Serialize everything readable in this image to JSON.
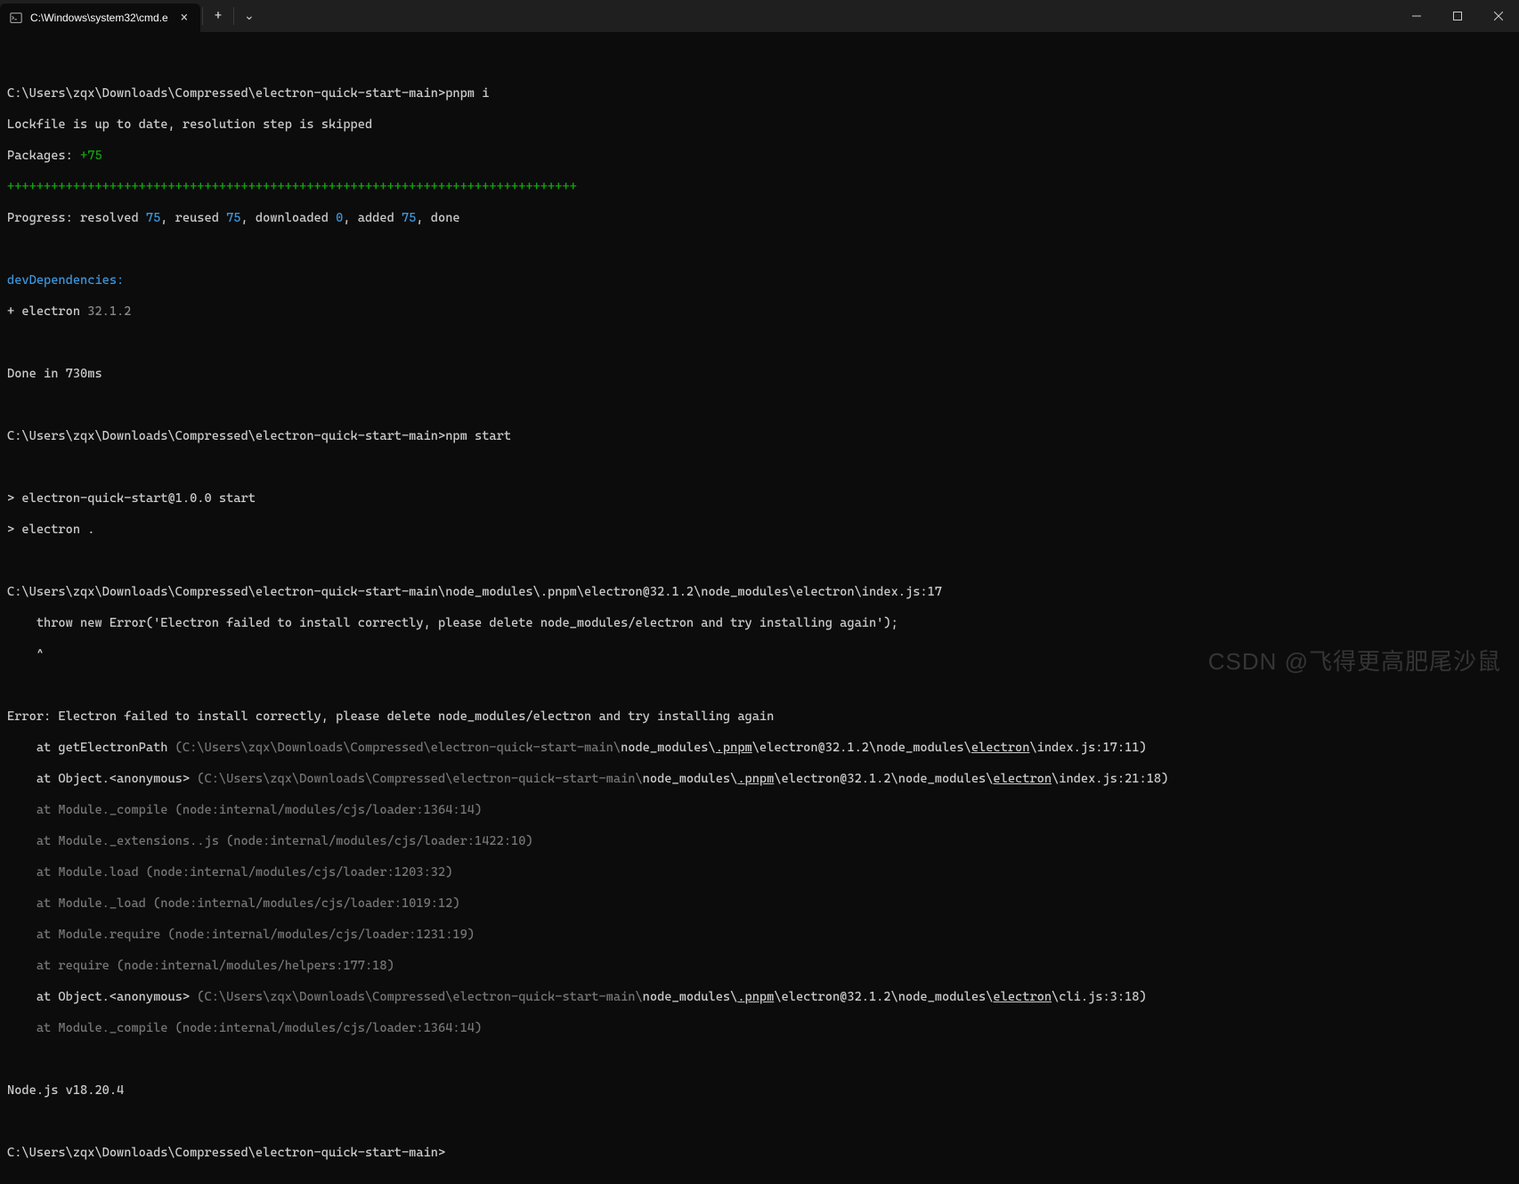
{
  "titlebar": {
    "tab_title": "C:\\Windows\\system32\\cmd.e",
    "tab_close": "×",
    "new_tab": "+",
    "dropdown": "⌄",
    "min": "—",
    "max": "□",
    "close": "×"
  },
  "term": {
    "l01_prompt": "C:\\Users\\zqx\\Downloads\\Compressed\\electron-quick-start-main>",
    "l01_cmd": "pnpm i",
    "l02": "Lockfile is up to date, resolution step is skipped",
    "l03a": "Packages: ",
    "l03b": "+75",
    "l04": "++++++++++++++++++++++++++++++++++++++++++++++++++++++++++++++++++++++++++++++",
    "l05_a": "Progress: resolved ",
    "l05_b": "75",
    "l05_c": ", reused ",
    "l05_d": "75",
    "l05_e": ", downloaded ",
    "l05_f": "0",
    "l05_g": ", added ",
    "l05_h": "75",
    "l05_i": ", done",
    "l07": "devDependencies:",
    "l08_a": "+ ",
    "l08_b": "electron ",
    "l08_c": "32.1.2",
    "l10": "Done in 730ms",
    "l12_prompt": "C:\\Users\\zqx\\Downloads\\Compressed\\electron-quick-start-main>",
    "l12_cmd": "npm start",
    "l14": "> electron-quick-start@1.0.0 start",
    "l15": "> electron .",
    "l17": "C:\\Users\\zqx\\Downloads\\Compressed\\electron-quick-start-main\\node_modules\\.pnpm\\electron@32.1.2\\node_modules\\electron\\index.js:17",
    "l18": "    throw new Error('Electron failed to install correctly, please delete node_modules/electron and try installing again');",
    "l19": "    ^",
    "l21": "Error: Electron failed to install correctly, please delete node_modules/electron and try installing again",
    "l22_a": "    at getElectronPath ",
    "l22_b": "(C:\\Users\\zqx\\Downloads\\Compressed\\electron-quick-start-main\\",
    "l22_c": "node_modules\\",
    "l22_d": ".pnpm",
    "l22_e": "\\electron@32.1.2\\node_modules\\",
    "l22_f": "electron",
    "l22_g": "\\index.js:17:11)",
    "l23_a": "    at Object.<anonymous> ",
    "l23_b": "(C:\\Users\\zqx\\Downloads\\Compressed\\electron-quick-start-main\\",
    "l23_c": "node_modules\\",
    "l23_d": ".pnpm",
    "l23_e": "\\electron@32.1.2\\node_modules\\",
    "l23_f": "electron",
    "l23_g": "\\index.js:21:18)",
    "l24": "    at Module._compile (node:internal/modules/cjs/loader:1364:14)",
    "l25": "    at Module._extensions..js (node:internal/modules/cjs/loader:1422:10)",
    "l26": "    at Module.load (node:internal/modules/cjs/loader:1203:32)",
    "l27": "    at Module._load (node:internal/modules/cjs/loader:1019:12)",
    "l28": "    at Module.require (node:internal/modules/cjs/loader:1231:19)",
    "l29": "    at require (node:internal/modules/helpers:177:18)",
    "l30_a": "    at Object.<anonymous> ",
    "l30_b": "(C:\\Users\\zqx\\Downloads\\Compressed\\electron-quick-start-main\\",
    "l30_c": "node_modules\\",
    "l30_d": ".pnpm",
    "l30_e": "\\electron@32.1.2\\node_modules\\",
    "l30_f": "electron",
    "l30_g": "\\cli.js:3:18)",
    "l31": "    at Module._compile (node:internal/modules/cjs/loader:1364:14)",
    "l33": "Node.js v18.20.4",
    "l35": "C:\\Users\\zqx\\Downloads\\Compressed\\electron-quick-start-main>"
  },
  "watermark": "CSDN @飞得更高肥尾沙鼠"
}
